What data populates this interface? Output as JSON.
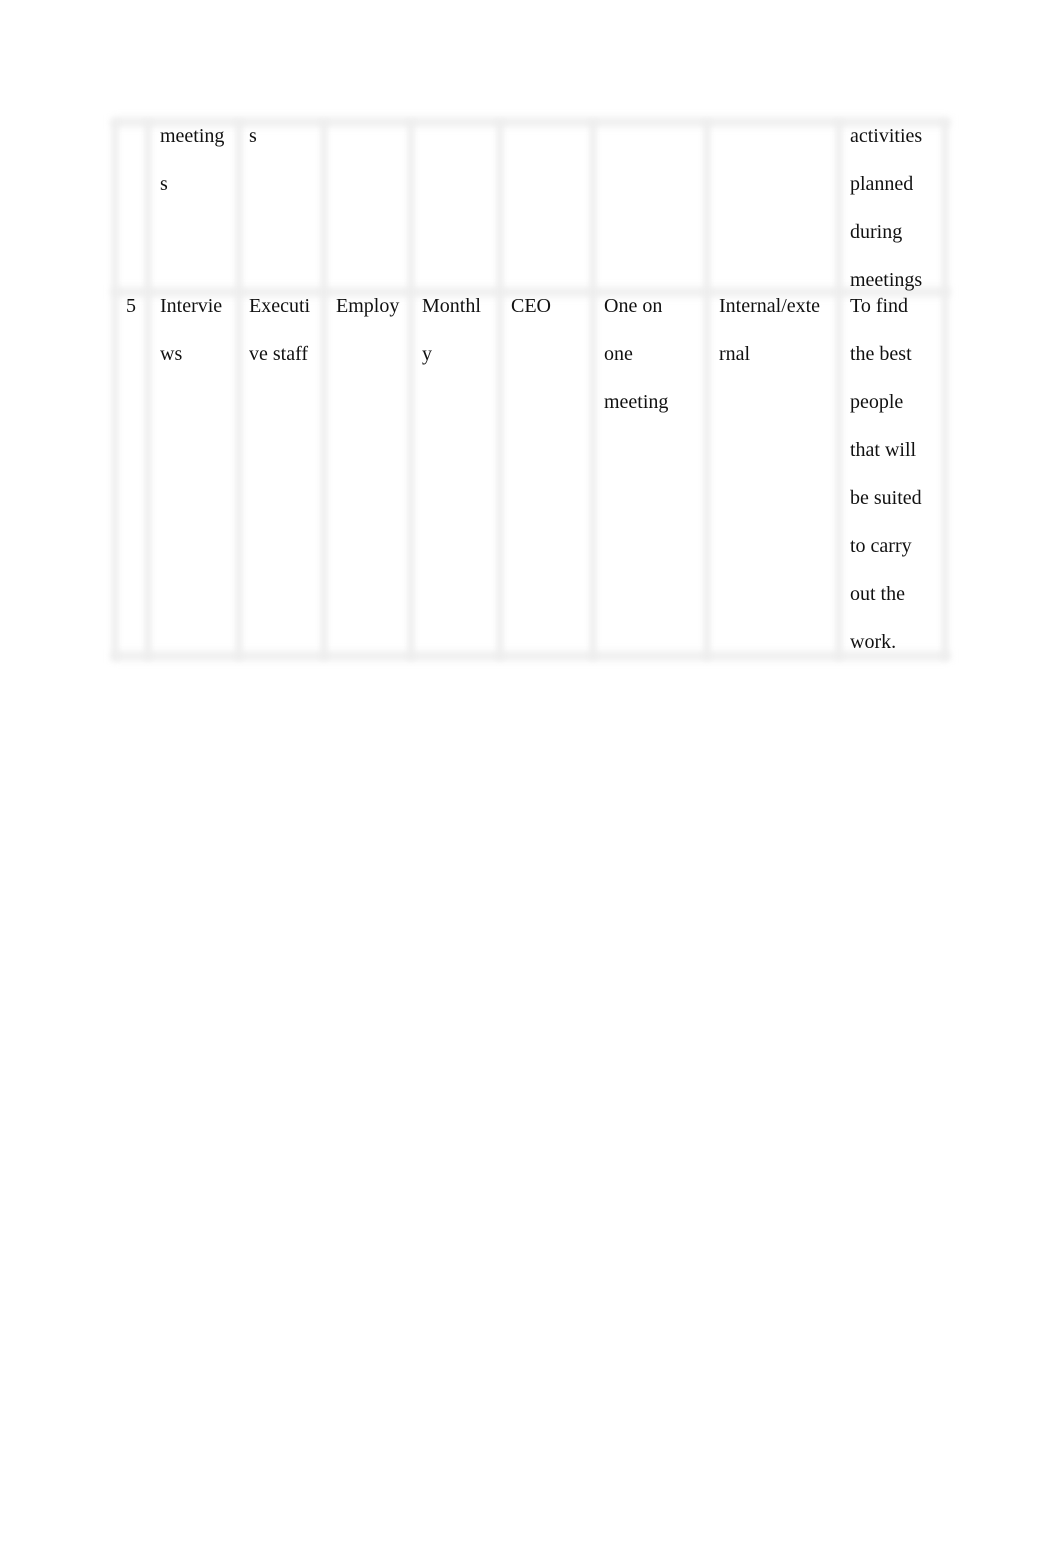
{
  "table": {
    "rows": [
      {
        "cells": [
          "",
          "meeting\ns",
          "s",
          "",
          "",
          "",
          "",
          "",
          "activities\nplanned\nduring\nmeetings"
        ]
      },
      {
        "cells": [
          "5",
          "Intervie\nws",
          "Executi\nve staff",
          "Employ",
          "Monthl\ny",
          "CEO",
          "One on\none\nmeeting",
          "Internal/exte\nrnal",
          "To find\nthe best\npeople\nthat will\nbe suited\nto carry\nout the\nwork."
        ]
      }
    ]
  }
}
